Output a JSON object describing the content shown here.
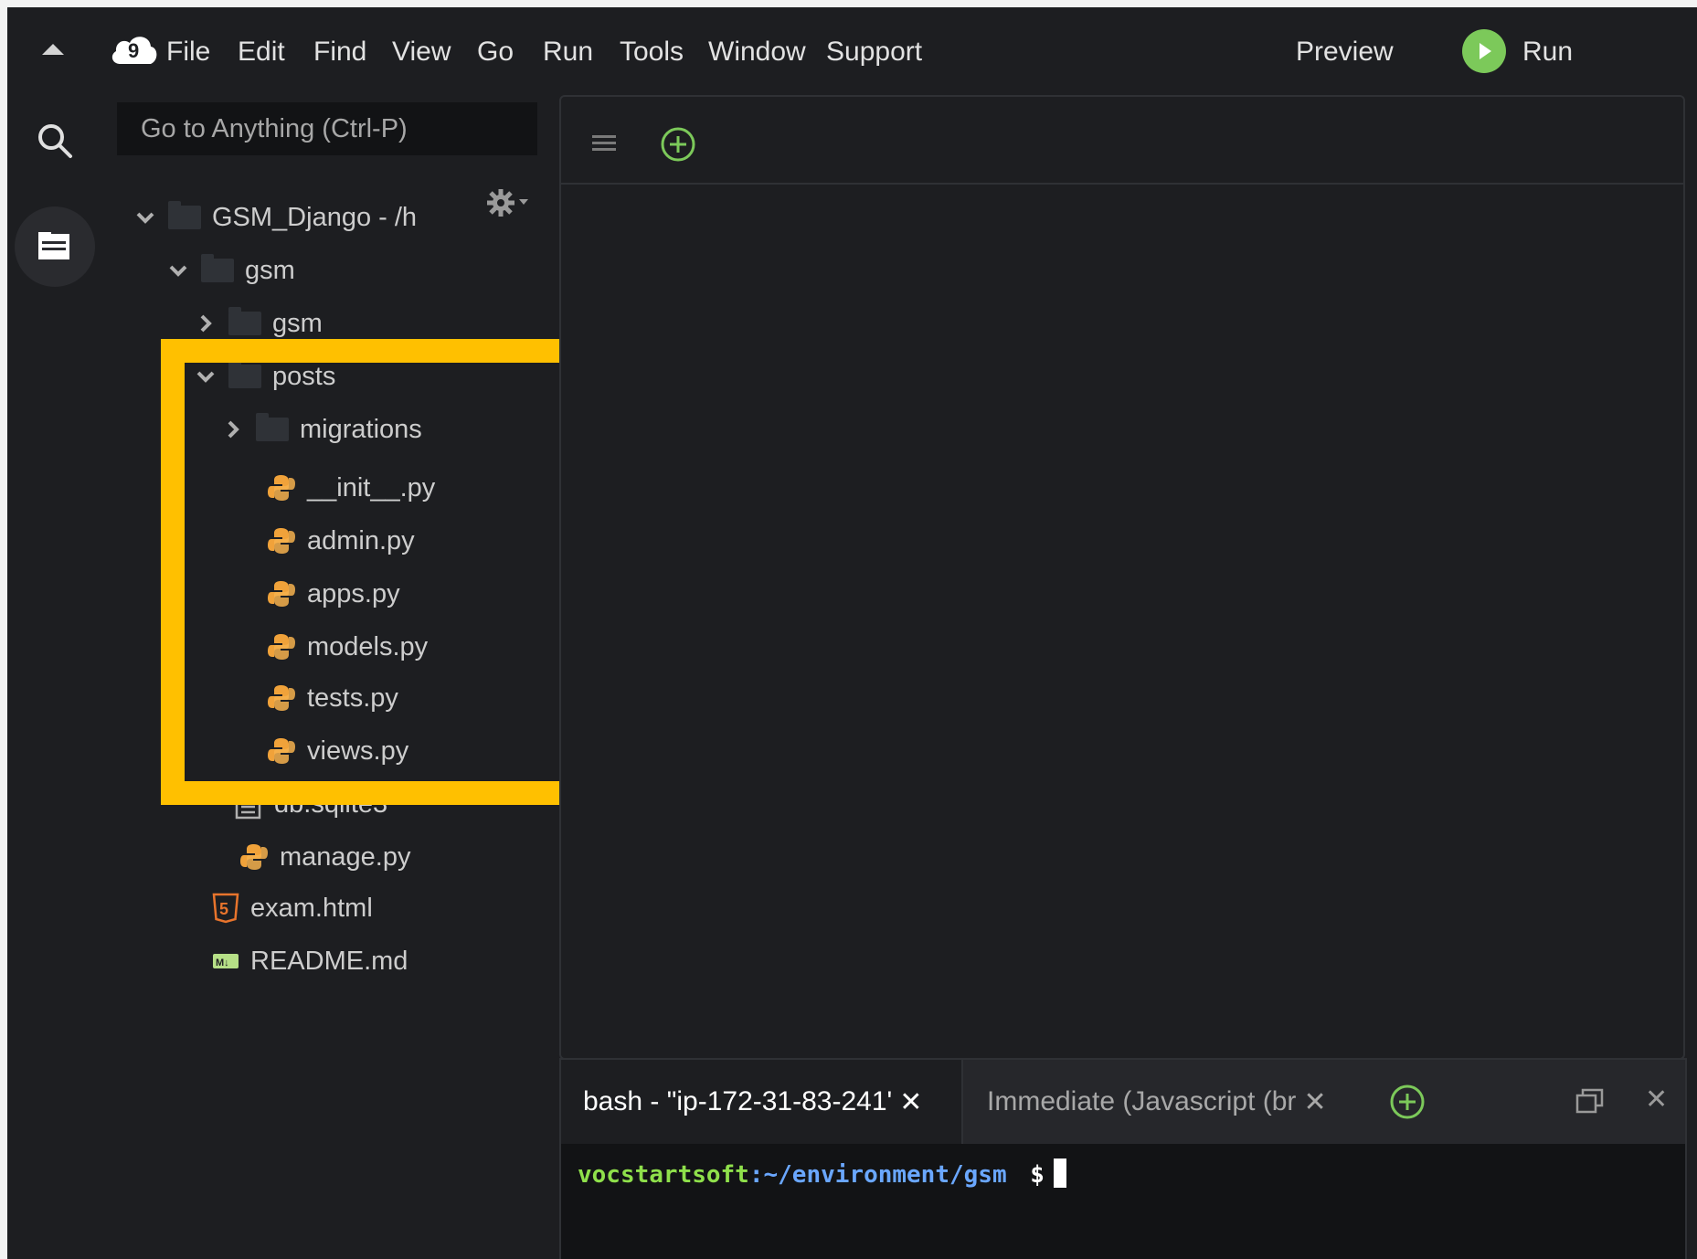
{
  "menubar": {
    "items": [
      "File",
      "Edit",
      "Find",
      "View",
      "Go",
      "Run",
      "Tools",
      "Window",
      "Support"
    ],
    "preview_label": "Preview",
    "run_label": "Run"
  },
  "sidebar": {
    "goto_placeholder": "Go to Anything (Ctrl-P)",
    "tree": [
      {
        "label": "GSM_Django - /h",
        "type": "folder",
        "expanded": true,
        "depth": 0
      },
      {
        "label": "gsm",
        "type": "folder",
        "expanded": true,
        "depth": 1
      },
      {
        "label": "gsm",
        "type": "folder",
        "expanded": false,
        "depth": 2
      },
      {
        "label": "posts",
        "type": "folder",
        "expanded": true,
        "depth": 2
      },
      {
        "label": "migrations",
        "type": "folder",
        "expanded": false,
        "depth": 3
      },
      {
        "label": "__init__.py",
        "type": "python",
        "depth": 3
      },
      {
        "label": "admin.py",
        "type": "python",
        "depth": 3
      },
      {
        "label": "apps.py",
        "type": "python",
        "depth": 3
      },
      {
        "label": "models.py",
        "type": "python",
        "depth": 3
      },
      {
        "label": "tests.py",
        "type": "python",
        "depth": 3
      },
      {
        "label": "views.py",
        "type": "python",
        "depth": 3
      },
      {
        "label": "db.sqlite3",
        "type": "text",
        "depth": 2
      },
      {
        "label": "manage.py",
        "type": "python",
        "depth": 2
      },
      {
        "label": "exam.html",
        "type": "html",
        "depth": 1
      },
      {
        "label": "README.md",
        "type": "markdown",
        "depth": 1
      }
    ]
  },
  "terminal": {
    "tabs": [
      {
        "label": "bash - \"ip-172-31-83-241'",
        "active": true
      },
      {
        "label": "Immediate (Javascript (br",
        "active": false
      }
    ],
    "prompt_user": "vocstartsoft",
    "prompt_path": ":~/environment/gsm",
    "prompt_symbol": "$"
  },
  "colors": {
    "highlight": "#ffc000",
    "accent_green": "#7cc95a",
    "python_icon": "#f0a23a",
    "html_icon": "#e8742c",
    "prompt_user": "#8fe04b",
    "prompt_path": "#6aa7ff"
  },
  "icons": [
    "collapse-arrow-icon",
    "cloud9-logo",
    "search-icon",
    "file-tree-icon",
    "gear-icon",
    "hamburger-icon",
    "add-tab-icon",
    "python-file-icon",
    "text-file-icon",
    "html5-icon",
    "markdown-icon",
    "restore-icon",
    "close-icon"
  ]
}
